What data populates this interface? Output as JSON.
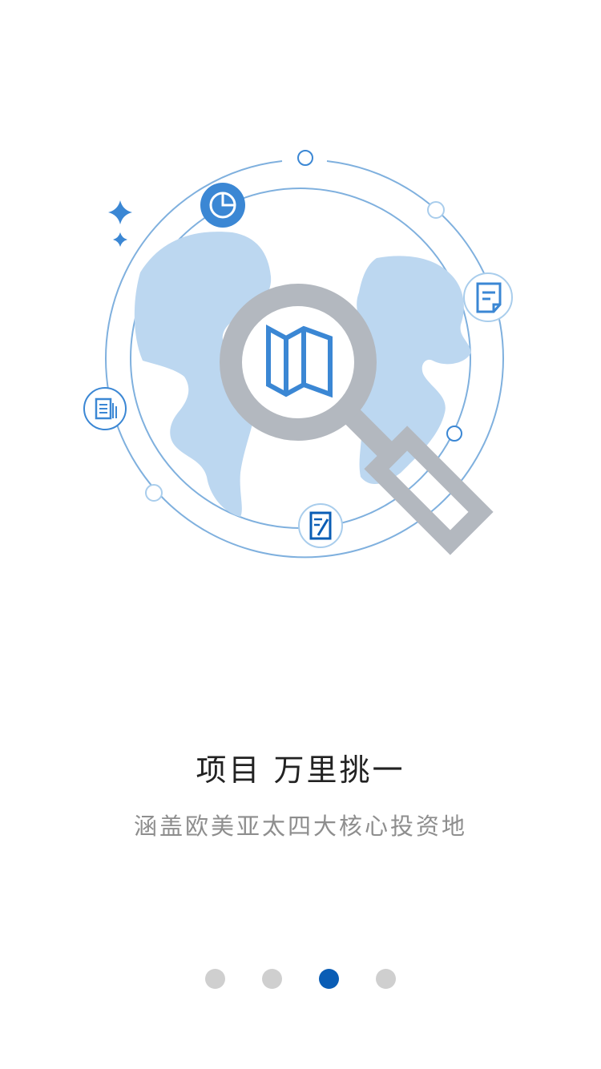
{
  "slide": {
    "title": "项目 万里挑一",
    "subtitle": "涵盖欧美亚太四大核心投资地"
  },
  "pager": {
    "total": 4,
    "active_index": 2
  },
  "illustration": {
    "center_icon": "folded-map-icon",
    "search_icon": "magnifier-icon",
    "orbit_icons": [
      "pie-chart-icon",
      "document-icon",
      "note-icon",
      "edit-icon"
    ]
  },
  "colors": {
    "accent": "#0a5db5",
    "icon_blue": "#3b87d4",
    "land": "#bcd7f0",
    "ring": "#7fb0de",
    "magnifier": "#b3b8bf",
    "title": "#222222",
    "subtitle": "#8e8e8e",
    "dot_inactive": "#cfcfcf"
  }
}
